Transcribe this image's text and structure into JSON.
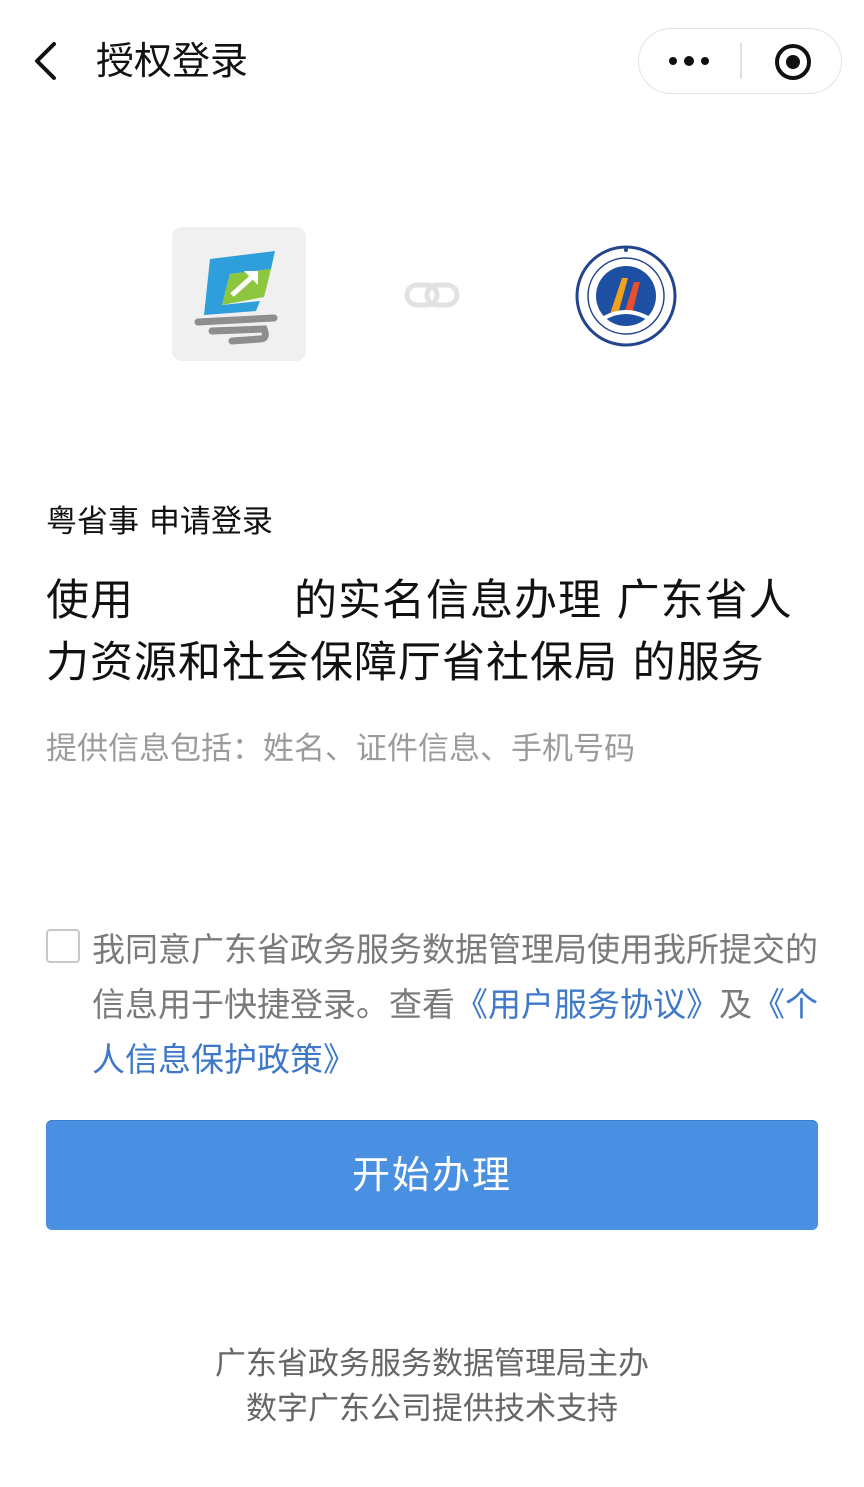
{
  "header": {
    "title": "授权登录",
    "back_icon": "chevron-left-icon",
    "more_icon": "more-dots-icon",
    "close_icon": "target-close-icon"
  },
  "logos": {
    "app_logo": "yue-sheng-shi-logo",
    "link_icon": "link-icon",
    "dept_logo": "guangdong-hrss-dept-emblem"
  },
  "auth": {
    "apply_line": "粤省事 申请登录",
    "use_prefix": "使用",
    "use_suffix": "的实名信息办理 广东省人力资源和社会保障厅省社保局 的服务",
    "info_provided": "提供信息包括：姓名、证件信息、手机号码"
  },
  "agreement": {
    "checked": false,
    "text": "我同意广东省政务服务数据管理局使用我所提交的信息用于快捷登录。查看",
    "user_agreement": "《用户服务协议》",
    "and": "及",
    "privacy_policy": "《个人信息保护政策》"
  },
  "button": {
    "start_label": "开始办理"
  },
  "footer": {
    "line1": "广东省政务服务数据管理局主办",
    "line2": "数字广东公司提供技术支持"
  },
  "colors": {
    "primary_button": "#4a90e2",
    "link": "#3e78c8",
    "secondary_text": "#9b9b9b"
  }
}
